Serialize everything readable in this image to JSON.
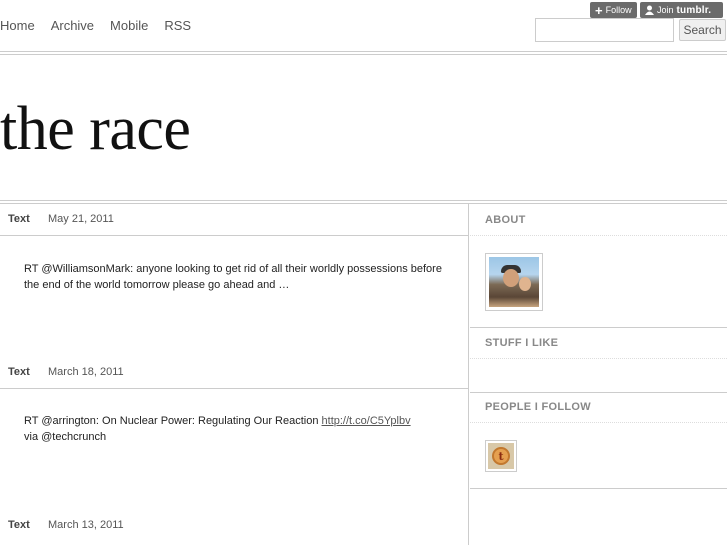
{
  "topbar": {
    "follow_label": "Follow",
    "join_label": "Join",
    "join_brand": "tumblr."
  },
  "nav": {
    "items": [
      "Home",
      "Archive",
      "Mobile",
      "RSS"
    ]
  },
  "search": {
    "placeholder": "",
    "button_label": "Search"
  },
  "site": {
    "title": "the race"
  },
  "posts": [
    {
      "type": "Text",
      "date": "May 21, 2011",
      "body": "RT @WilliamsonMark: anyone looking to get rid of all their worldly possessions before the end of the world tomorrow please go ahead and …"
    },
    {
      "type": "Text",
      "date": "March 18, 2011",
      "body_before": "RT @arrington: On Nuclear Power: Regulating Our Reaction ",
      "link": "http://t.co/C5Yplbv",
      "body_after": " via @techcrunch"
    },
    {
      "type": "Text",
      "date": "March 13, 2011"
    }
  ],
  "sidebar": {
    "about_heading": "ABOUT",
    "stuff_heading": "STUFF I LIKE",
    "people_heading": "PEOPLE I FOLLOW",
    "follow_badge_letter": "t"
  }
}
